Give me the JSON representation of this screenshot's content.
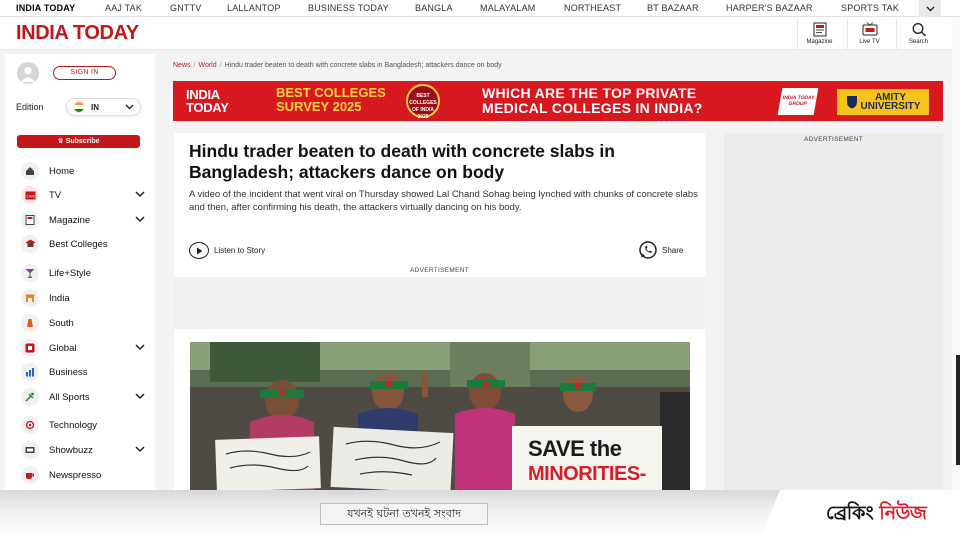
{
  "network_bar": {
    "items": [
      "INDIA TODAY",
      "AAJ TAK",
      "GNTTV",
      "LALLANTOP",
      "BUSINESS TODAY",
      "BANGLA",
      "MALAYALAM",
      "NORTHEAST",
      "BT BAZAAR",
      "HARPER'S BAZAAR",
      "SPORTS TAK"
    ],
    "more_icon": "chevron-down-icon"
  },
  "header": {
    "logo_text": "INDIA TODAY",
    "brand_color": "#c4171c",
    "icons": [
      {
        "label": "Magazine",
        "icon": "magazine-icon"
      },
      {
        "label": "Live TV",
        "icon": "live-tv-icon"
      },
      {
        "label": "Search",
        "icon": "search-icon"
      }
    ]
  },
  "sidebar": {
    "signin_label": "SIGN IN",
    "edition_label": "Edition",
    "edition_value": "IN",
    "subscribe_label": "Subscribe",
    "items": [
      {
        "label": "Home",
        "icon": "home-icon",
        "expandable": false
      },
      {
        "label": "TV",
        "icon": "live-tv-icon",
        "expandable": true
      },
      {
        "label": "Magazine",
        "icon": "magazine-icon",
        "expandable": true
      },
      {
        "label": "Best Colleges",
        "icon": "college-icon",
        "expandable": false
      },
      {
        "label": "Life+Style",
        "icon": "cocktail-icon",
        "expandable": false
      },
      {
        "label": "India",
        "icon": "india-gate-icon",
        "expandable": false
      },
      {
        "label": "South",
        "icon": "temple-icon",
        "expandable": false
      },
      {
        "label": "Global",
        "icon": "globe-icon",
        "expandable": true
      },
      {
        "label": "Business",
        "icon": "chart-icon",
        "expandable": false
      },
      {
        "label": "All Sports",
        "icon": "sports-icon",
        "expandable": true
      },
      {
        "label": "Technology",
        "icon": "technology-icon",
        "expandable": false
      },
      {
        "label": "Showbuzz",
        "icon": "film-icon",
        "expandable": true
      },
      {
        "label": "Newspresso",
        "icon": "coffee-icon",
        "expandable": false
      }
    ]
  },
  "breadcrumb": {
    "items": [
      "News",
      "World",
      "Hindu trader beaten to death with concrete slabs in Bangladesh; attackers dance on body"
    ]
  },
  "banner_ad": {
    "logo": "INDIA TODAY",
    "survey_line1": "BEST COLLEGES",
    "survey_line2": "SURVEY 2025",
    "badge_text": "BEST COLLEGES OF INDIA 2025",
    "headline_line1": "WHICH ARE THE TOP PRIVATE",
    "headline_line2": "MEDICAL COLLEGES IN INDIA?",
    "group_text": "INDIA TODAY GROUP",
    "sponsor": "AMITY UNIVERSITY"
  },
  "article": {
    "headline": "Hindu trader beaten to death with concrete slabs in Bangladesh; attackers dance on body",
    "summary": "A video of the incident that went viral on Thursday showed Lal Chand Sohag being lynched with chunks of concrete slabs and then, after confirming his death, the attackers virtually dancing on his body.",
    "listen_label": "Listen to Story",
    "share_label": "Share",
    "ad_label": "ADVERTISEMENT",
    "photo_placard_1": "SAVE the",
    "photo_placard_2": "MINORITIES-"
  },
  "right_column": {
    "ad_label": "ADVERTISEMENT"
  },
  "ticker": {
    "tagline": "যখনই ঘটনা তখনই সংবাদ",
    "breaking_part1": "ব্রেকিং",
    "breaking_part2": "নিউজ"
  }
}
